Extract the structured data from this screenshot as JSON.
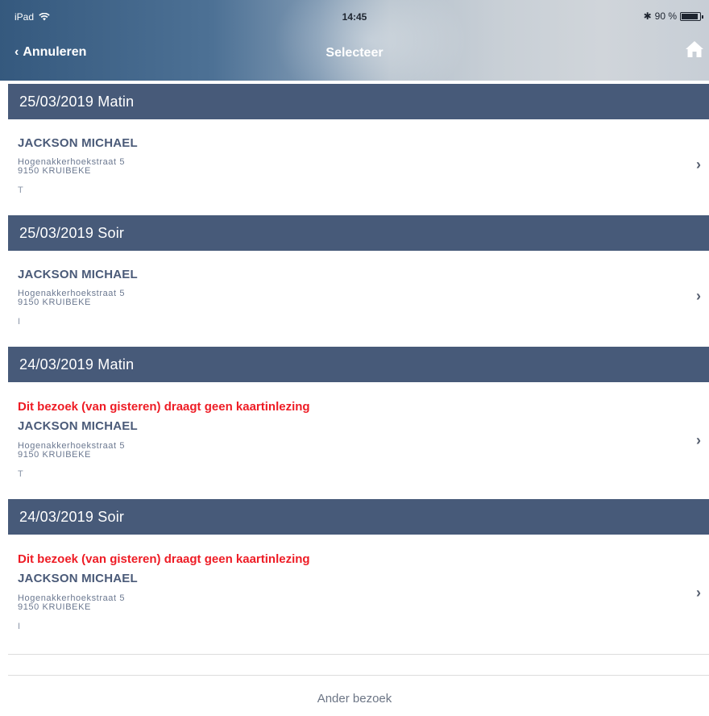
{
  "status_bar": {
    "carrier": "iPad",
    "time": "14:45",
    "battery": "90 %",
    "battery_level": 0.9
  },
  "nav": {
    "back_label": "Annuleren",
    "title": "Selecteer"
  },
  "sections": [
    {
      "header": "25/03/2019 Matin",
      "item": {
        "warning": "",
        "name": "JACKSON MICHAEL",
        "street": "Hogenakkerhoekstraat 5",
        "city": "9150 KRUIBEKE",
        "code": "T"
      }
    },
    {
      "header": "25/03/2019 Soir",
      "item": {
        "warning": "",
        "name": "JACKSON MICHAEL",
        "street": "Hogenakkerhoekstraat 5",
        "city": "9150 KRUIBEKE",
        "code": "I"
      }
    },
    {
      "header": "24/03/2019 Matin",
      "item": {
        "warning": "Dit bezoek (van gisteren) draagt geen kaartinlezing",
        "name": "JACKSON MICHAEL",
        "street": "Hogenakkerhoekstraat 5",
        "city": "9150 KRUIBEKE",
        "code": "T"
      }
    },
    {
      "header": "24/03/2019 Soir",
      "item": {
        "warning": "Dit bezoek (van gisteren) draagt geen kaartinlezing",
        "name": "JACKSON MICHAEL",
        "street": "Hogenakkerhoekstraat 5",
        "city": "9150 KRUIBEKE",
        "code": "I"
      }
    }
  ],
  "footer": {
    "other_visit_label": "Ander bezoek"
  },
  "colors": {
    "section_header_bg": "#475a79",
    "warning_text": "#ee1c25",
    "name_text": "#4a5a78"
  }
}
